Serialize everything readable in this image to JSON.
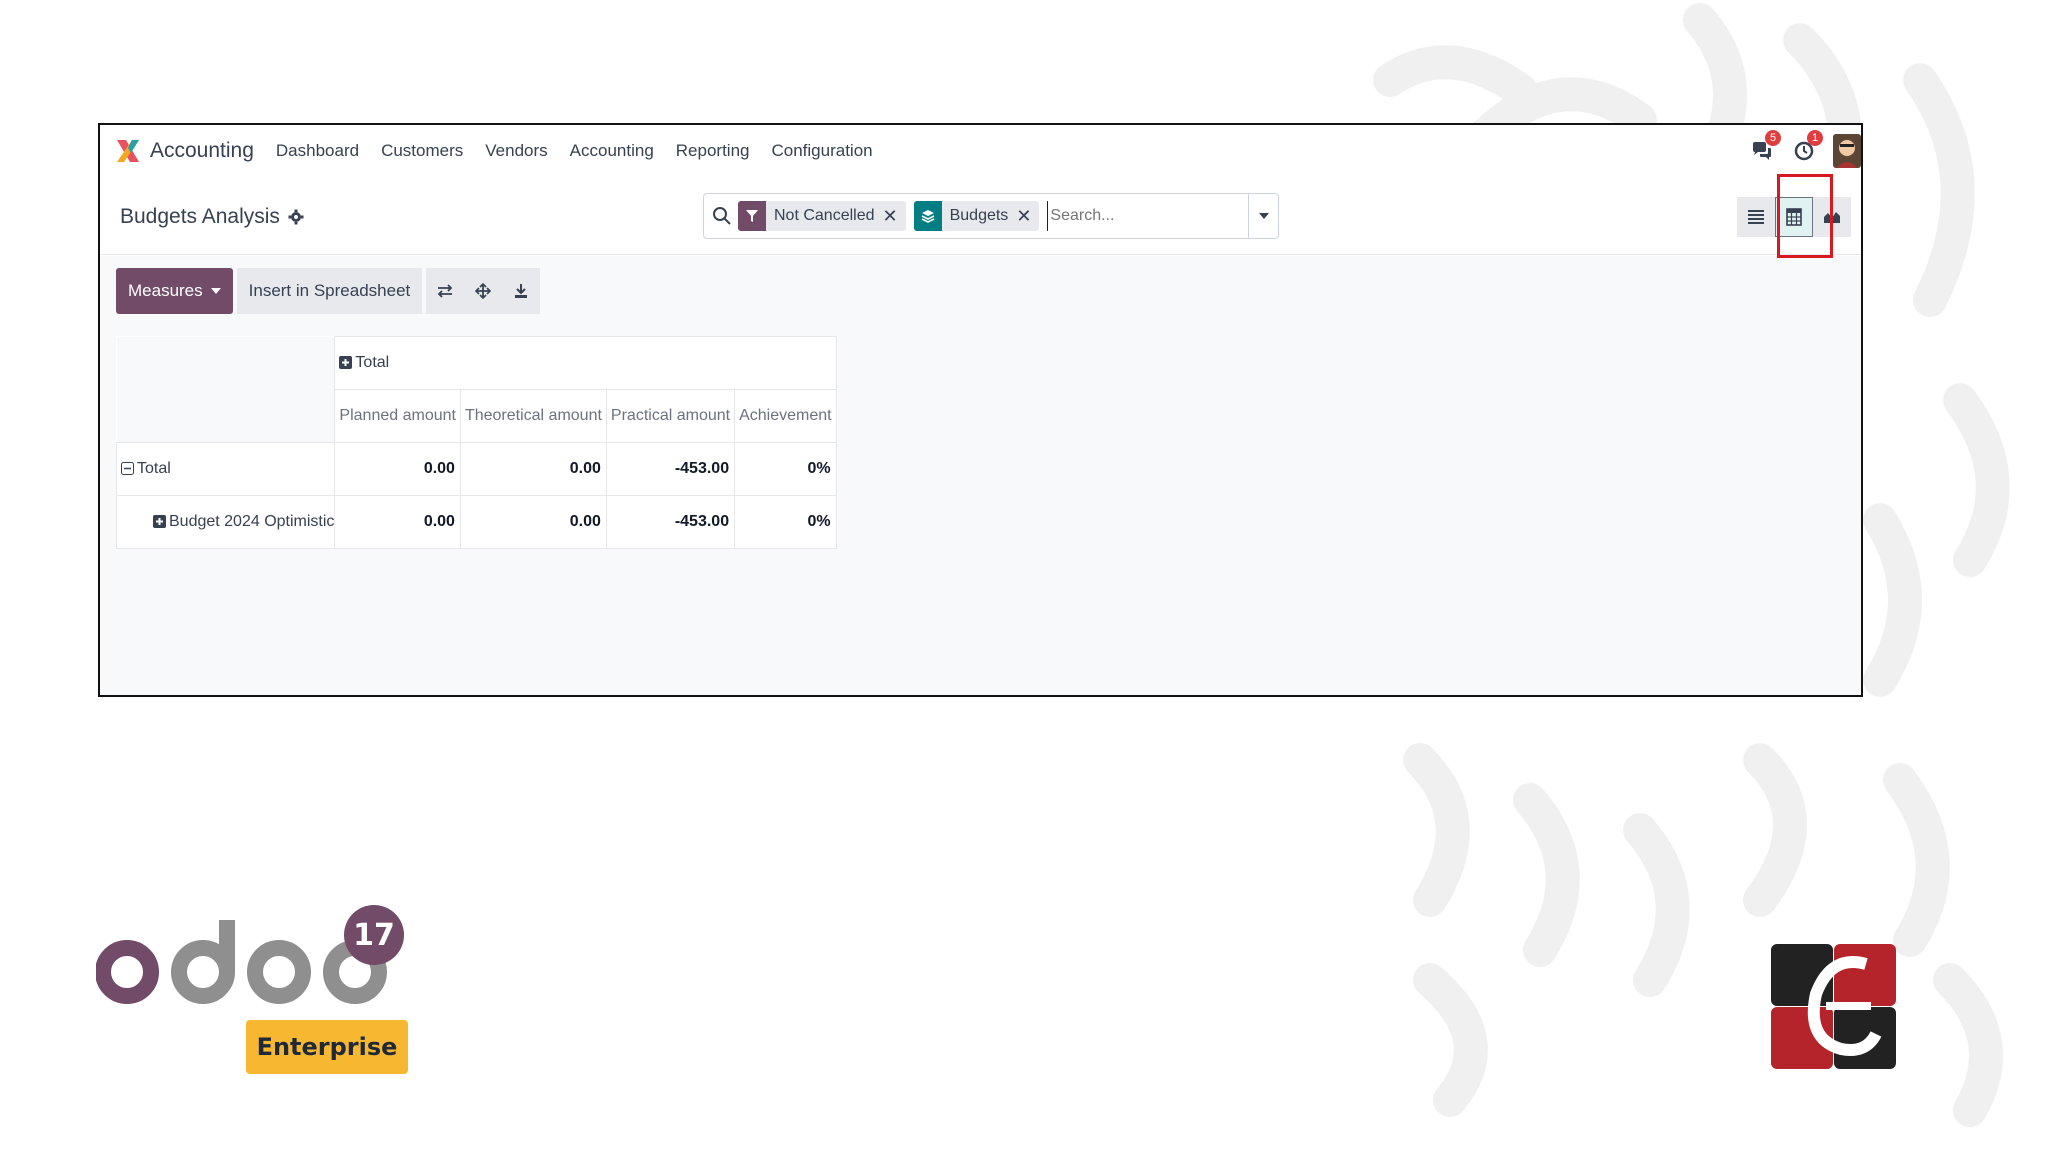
{
  "navbar": {
    "app_name": "Accounting",
    "menu": [
      "Dashboard",
      "Customers",
      "Vendors",
      "Accounting",
      "Reporting",
      "Configuration"
    ],
    "messages_count": "5",
    "activities_count": "1",
    "icons": [
      "chat-icon",
      "clock-icon",
      "avatar"
    ]
  },
  "breadcrumb": {
    "title": "Budgets Analysis"
  },
  "search": {
    "facets": [
      {
        "icon": "filter-icon",
        "label": "Not Cancelled",
        "color": "#714b67"
      },
      {
        "icon": "group-by-icon",
        "label": "Budgets",
        "color": "#017e84"
      }
    ],
    "placeholder": "Search..."
  },
  "views": {
    "active": "pivot",
    "items": [
      "list",
      "pivot",
      "graph"
    ]
  },
  "toolbar": {
    "measures_label": "Measures",
    "insert_label": "Insert in Spreadsheet",
    "icons": [
      "flip-axis-icon",
      "expand-all-icon",
      "download-icon"
    ]
  },
  "pivot": {
    "col_header": "Total",
    "measures": [
      "Planned amount",
      "Theoretical amount",
      "Practical amount",
      "Achievement"
    ],
    "rows": [
      {
        "label": "Total",
        "values": [
          "0.00",
          "0.00",
          "-453.00",
          "0%"
        ]
      },
      {
        "label": "Budget 2024 Optimistic",
        "values": [
          "0.00",
          "0.00",
          "-453.00",
          "0%"
        ]
      }
    ]
  },
  "branding": {
    "version": "17",
    "edition": "Enterprise"
  },
  "colors": {
    "accent": "#714b67",
    "highlight": "#d71920",
    "enterprise": "#f7b731"
  }
}
